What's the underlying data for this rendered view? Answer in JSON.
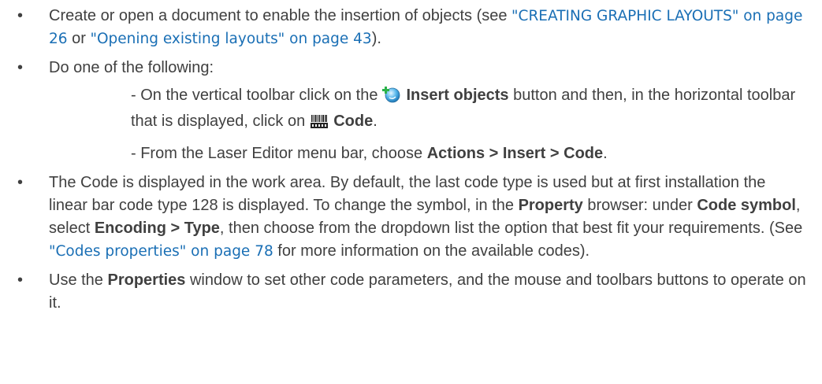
{
  "bullets": {
    "b1": {
      "t1": "Create or open a document to enable the insertion of objects (see ",
      "link1": "\"CREATING GRAPHIC LAYOUTS\" on page 26",
      "t2": " or ",
      "link2": "\"Opening existing layouts\" on page 43",
      "t3": ")."
    },
    "b2": {
      "text": "Do one of the following:",
      "sub1": {
        "t1": "- On the vertical toolbar click on the",
        "bold1": "Insert objects",
        "t2": " button and then, in the horizontal toolbar that is displayed, click on",
        "bold2": "Code",
        "t3": "."
      },
      "sub2": {
        "t1": "- From the Laser Editor menu bar, choose ",
        "bold1": "Actions > Insert > Code",
        "t2": "."
      }
    },
    "b3": {
      "t1": "The Code is displayed in the work area. By default, the last code type is used but at first installation the linear bar code type 128 is displayed. To change the symbol, in the ",
      "bold1": "Property",
      "t2": " browser: under ",
      "bold2": "Code symbol",
      "t3": ", select ",
      "bold3": "Encoding > Type",
      "t4": ", then choose from the dropdown list the option that best fit your requirements. (See ",
      "link1": "\"Codes properties\" on page 78",
      "t5": " for more information on the available codes)."
    },
    "b4": {
      "t1": "Use the ",
      "bold1": "Properties",
      "t2": " window to set other code parameters, and the mouse and toolbars buttons to operate on it."
    }
  },
  "icons": {
    "insert_objects": "insert-objects-icon",
    "code": "barcode-icon"
  },
  "colors": {
    "text": "#404040",
    "link": "#1a6fb5"
  }
}
